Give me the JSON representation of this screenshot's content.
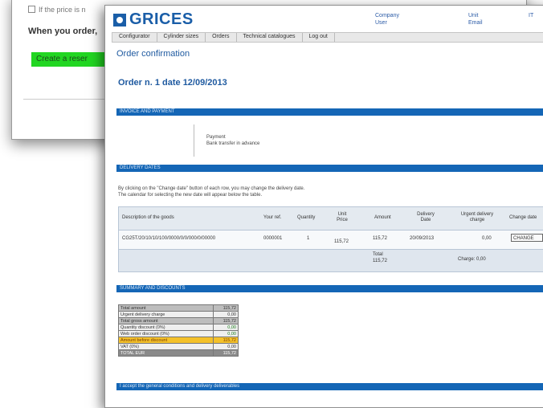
{
  "back_window": {
    "checkbox_text": "If the price is n",
    "line2": "When you order,",
    "green_button": "Create a reser"
  },
  "front_window": {
    "logo": "GRICES",
    "header_links": [
      {
        "line1": "Company",
        "line2": "User"
      },
      {
        "line1": "Unit",
        "line2": "Email"
      },
      {
        "line1": "IT"
      }
    ],
    "nav_items": [
      "Configurator",
      "Cylinder sizes",
      "Orders",
      "Technical catalogues",
      "Log out"
    ],
    "page_title": "Order confirmation",
    "order_title": "Order n. 1 date 12/09/2013",
    "sections": {
      "invoice": "INVOICE AND PAYMENT",
      "delivery": "DELIVERY DATES",
      "summary": "SUMMARY AND DISCOUNTS",
      "footer": "I accept the general conditions and delivery deliverables"
    },
    "info_lines": [
      "Payment",
      "Bank transfer in advance"
    ],
    "note_lines": [
      "By clicking on the \"Change date\" button of each row, you may change the delivery date.",
      "The calendar for selecting the new date will appear below the table."
    ],
    "table": {
      "headers": [
        "Description of the goods",
        "Your ref.",
        "Quantity",
        "Unit Price",
        "Amount",
        "Delivery Date",
        "Urgent delivery charge",
        "Change date"
      ],
      "row": [
        "CG25T/20/10/10/100/0000/0/0/000/0/00000",
        "0000001",
        "1",
        "115,72",
        "115,72",
        "20/09/2013",
        "0,00",
        "CHANGE"
      ],
      "total_label": "Total",
      "total_value": "115,72",
      "charge_text": "Charge: 0,00"
    },
    "summary_rows": [
      {
        "label": "Total amount",
        "value": "115,72",
        "style": "total"
      },
      {
        "label": "Urgent delivery charge",
        "value": "0,00",
        "style": "light"
      },
      {
        "label": "Total gross amount",
        "value": "115,72",
        "style": "total"
      },
      {
        "label": "Quantity discount (0%)",
        "value": "0,00",
        "style": "green"
      },
      {
        "label": "Web order discount (0%)",
        "value": "0,00",
        "style": "green"
      },
      {
        "label": "Amount before discount",
        "value": "115,72",
        "style": "hl"
      },
      {
        "label": "VAT (0%)",
        "value": "0,00",
        "style": "light"
      },
      {
        "label": "TOTAL EUR",
        "value": "115,72",
        "style": "dark"
      }
    ]
  }
}
